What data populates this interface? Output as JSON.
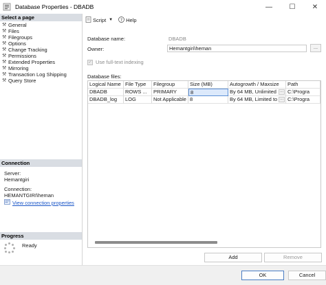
{
  "window": {
    "title": "Database Properties - DBADB",
    "minimize": "—",
    "maximize": "☐",
    "close": "✕"
  },
  "left": {
    "select_page_header": "Select a page",
    "pages": [
      "General",
      "Files",
      "Filegroups",
      "Options",
      "Change Tracking",
      "Permissions",
      "Extended Properties",
      "Mirroring",
      "Transaction Log Shipping",
      "Query Store"
    ],
    "connection_header": "Connection",
    "server_label": "Server:",
    "server_value": "Hemantgiri",
    "connection_label": "Connection:",
    "connection_value": "HEMANTGIRI\\heman",
    "view_link": "View connection properties",
    "progress_header": "Progress",
    "progress_status": "Ready"
  },
  "toolbar": {
    "script_label": "Script",
    "help_label": "Help"
  },
  "main": {
    "db_name_label": "Database name:",
    "db_name_value": "DBADB",
    "owner_label": "Owner:",
    "owner_value": "Hemantgiri\\heman",
    "owner_browse": "...",
    "fulltext_label": "Use full-text indexing",
    "files_label": "Database files:",
    "columns": [
      "Logical Name",
      "File Type",
      "Filegroup",
      "Size (MB)",
      "Autogrowth / Maxsize",
      "Path"
    ],
    "rows": [
      {
        "logical": "DBADB",
        "type": "ROWS ...",
        "filegroup": "PRIMARY",
        "size": "8",
        "autogrowth": "By 64 MB, Unlimited",
        "path": "C:\\Progra"
      },
      {
        "logical": "DBADB_log",
        "type": "LOG",
        "filegroup": "Not Applicable",
        "size": "8",
        "autogrowth": "By 64 MB, Limited to ...",
        "path": "C:\\Progra"
      }
    ],
    "add_label": "Add",
    "remove_label": "Remove"
  },
  "footer": {
    "ok_label": "OK",
    "cancel_label": "Cancel"
  },
  "colors": {
    "accent": "#1a56c8",
    "header_bg": "#d9dde3",
    "selection": "#dce9fb"
  }
}
